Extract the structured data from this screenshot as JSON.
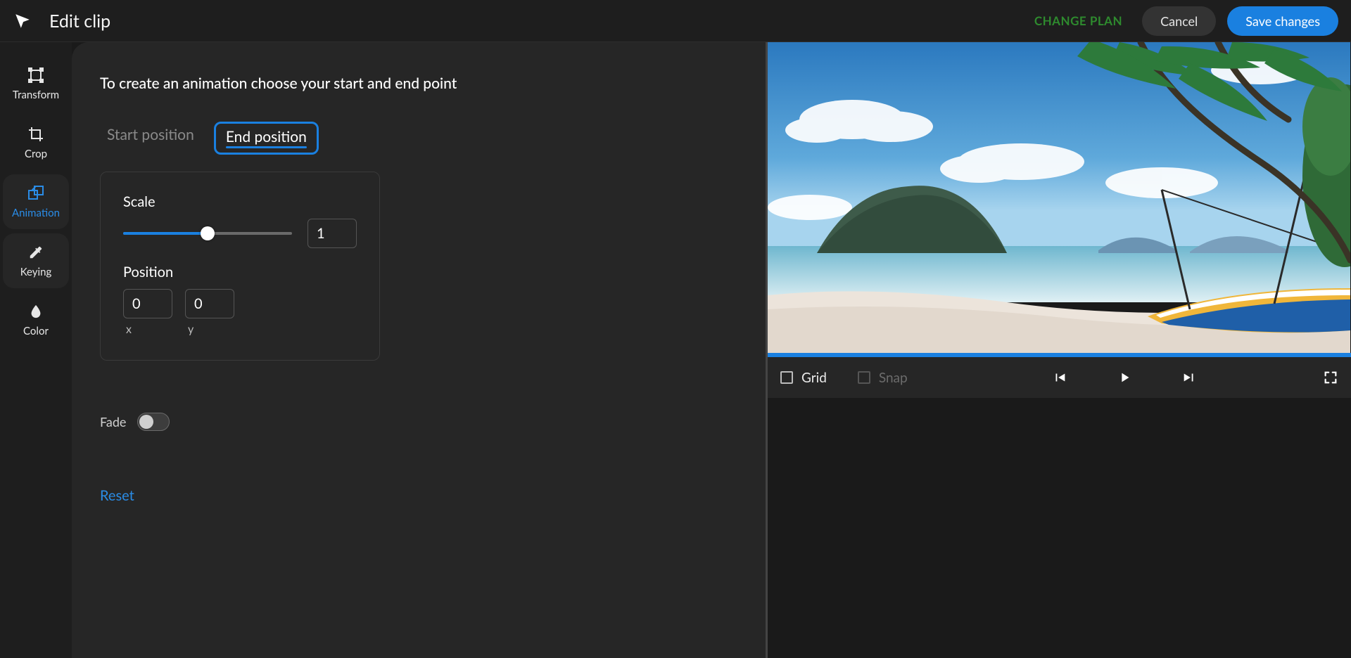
{
  "header": {
    "title": "Edit clip",
    "change_plan": "CHANGE PLAN",
    "cancel": "Cancel",
    "save": "Save changes"
  },
  "sidebar": {
    "items": [
      {
        "id": "transform",
        "label": "Transform",
        "active": false
      },
      {
        "id": "crop",
        "label": "Crop",
        "active": false
      },
      {
        "id": "animation",
        "label": "Animation",
        "active": true
      },
      {
        "id": "keying",
        "label": "Keying",
        "active": false
      },
      {
        "id": "color",
        "label": "Color",
        "active": false
      }
    ]
  },
  "panel": {
    "instruction": "To create an animation choose your start and end point",
    "tabs": {
      "start": "Start position",
      "end": "End position",
      "active": "end"
    },
    "scale": {
      "label": "Scale",
      "value": "1",
      "ratio": 0.5
    },
    "position": {
      "label": "Position",
      "x_label": "x",
      "y_label": "y",
      "x": "0",
      "y": "0"
    },
    "fade": {
      "label": "Fade",
      "on": false
    },
    "reset": "Reset"
  },
  "controls": {
    "grid": "Grid",
    "snap": "Snap"
  },
  "icons": {
    "logo": "app-logo",
    "transform": "transform-icon",
    "crop": "crop-icon",
    "animation": "animation-icon",
    "keying": "eyedropper-icon",
    "color": "droplet-icon",
    "prev": "skip-previous-icon",
    "play": "play-icon",
    "next": "skip-next-icon",
    "fullscreen": "fullscreen-icon"
  }
}
